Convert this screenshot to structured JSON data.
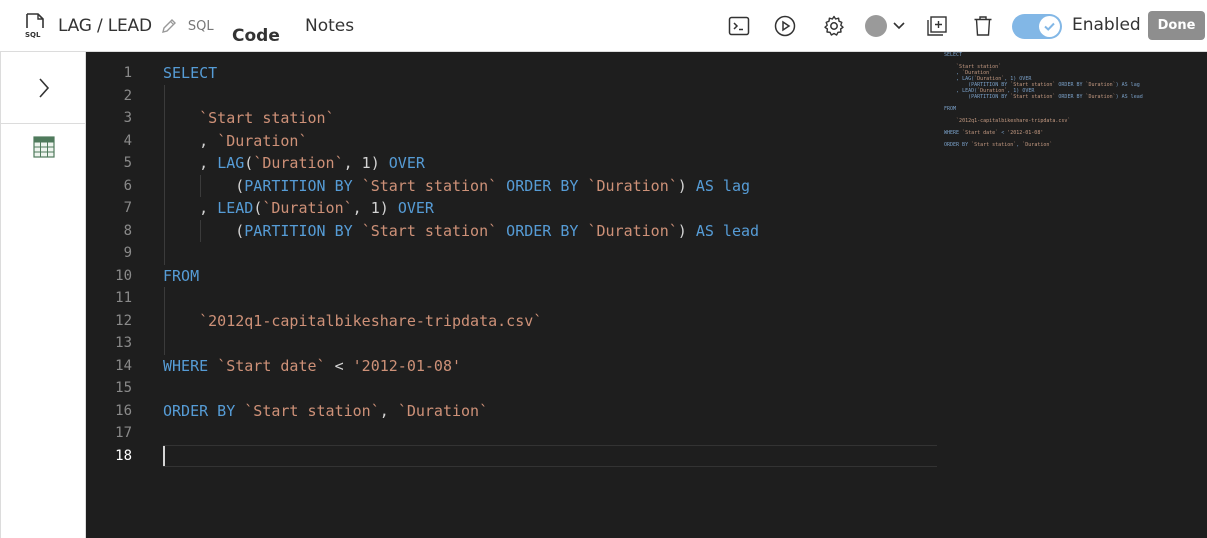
{
  "header": {
    "title": "LAG / LEAD",
    "sql_tag": "SQL",
    "tabs": [
      {
        "label": "Code",
        "active": true
      },
      {
        "label": "Notes",
        "active": false
      }
    ],
    "enabled_label": "Enabled",
    "enabled": true,
    "done_label": "Done"
  },
  "icons": {
    "file": "sql-file-icon",
    "edit": "pencil-icon",
    "terminal": "terminal-icon",
    "run": "play-icon",
    "settings": "gear-icon",
    "status": "status-dot-icon",
    "add": "add-cell-icon",
    "delete": "trash-icon",
    "expand": "chevron-right-icon",
    "table": "table-icon"
  },
  "colors": {
    "accent": "#82b7e6",
    "editor_bg": "#1e1e1e",
    "keyword": "#569cd6",
    "identifier": "#ce9178",
    "done_bg": "#8e8e8e"
  },
  "editor": {
    "line_numbers": [
      "1",
      "2",
      "3",
      "4",
      "5",
      "6",
      "7",
      "8",
      "9",
      "10",
      "11",
      "12",
      "13",
      "14",
      "15",
      "16",
      "17",
      "18"
    ],
    "active_line": 18,
    "lines": [
      [
        {
          "t": "kw",
          "v": "SELECT"
        }
      ],
      [],
      [
        {
          "t": "sp",
          "v": "    "
        },
        {
          "t": "id",
          "v": "`Start station`"
        }
      ],
      [
        {
          "t": "sp",
          "v": "    "
        },
        {
          "t": "pn",
          "v": ", "
        },
        {
          "t": "id",
          "v": "`Duration`"
        }
      ],
      [
        {
          "t": "sp",
          "v": "    "
        },
        {
          "t": "pn",
          "v": ", "
        },
        {
          "t": "fn",
          "v": "LAG"
        },
        {
          "t": "pn",
          "v": "("
        },
        {
          "t": "id",
          "v": "`Duration`"
        },
        {
          "t": "pn",
          "v": ", 1) "
        },
        {
          "t": "kw",
          "v": "OVER"
        }
      ],
      [
        {
          "t": "sp",
          "v": "        "
        },
        {
          "t": "pn",
          "v": "("
        },
        {
          "t": "kw",
          "v": "PARTITION BY "
        },
        {
          "t": "id",
          "v": "`Start station`"
        },
        {
          "t": "kw",
          "v": " ORDER BY "
        },
        {
          "t": "id",
          "v": "`Duration`"
        },
        {
          "t": "pn",
          "v": ") "
        },
        {
          "t": "kw",
          "v": "AS lag"
        }
      ],
      [
        {
          "t": "sp",
          "v": "    "
        },
        {
          "t": "pn",
          "v": ", "
        },
        {
          "t": "fn",
          "v": "LEAD"
        },
        {
          "t": "pn",
          "v": "("
        },
        {
          "t": "id",
          "v": "`Duration`"
        },
        {
          "t": "pn",
          "v": ", 1) "
        },
        {
          "t": "kw",
          "v": "OVER"
        }
      ],
      [
        {
          "t": "sp",
          "v": "        "
        },
        {
          "t": "pn",
          "v": "("
        },
        {
          "t": "kw",
          "v": "PARTITION BY "
        },
        {
          "t": "id",
          "v": "`Start station`"
        },
        {
          "t": "kw",
          "v": " ORDER BY "
        },
        {
          "t": "id",
          "v": "`Duration`"
        },
        {
          "t": "pn",
          "v": ") "
        },
        {
          "t": "kw",
          "v": "AS lead"
        }
      ],
      [],
      [
        {
          "t": "kw",
          "v": "FROM"
        }
      ],
      [],
      [
        {
          "t": "sp",
          "v": "    "
        },
        {
          "t": "id",
          "v": "`2012q1-capitalbikeshare-tripdata.csv`"
        }
      ],
      [],
      [
        {
          "t": "kw",
          "v": "WHERE "
        },
        {
          "t": "id",
          "v": "`Start date`"
        },
        {
          "t": "pn",
          "v": " < "
        },
        {
          "t": "str",
          "v": "'2012-01-08'"
        }
      ],
      [],
      [
        {
          "t": "kw",
          "v": "ORDER BY "
        },
        {
          "t": "id",
          "v": "`Start station`"
        },
        {
          "t": "pn",
          "v": ", "
        },
        {
          "t": "id",
          "v": "`Duration`"
        }
      ],
      [],
      []
    ]
  }
}
